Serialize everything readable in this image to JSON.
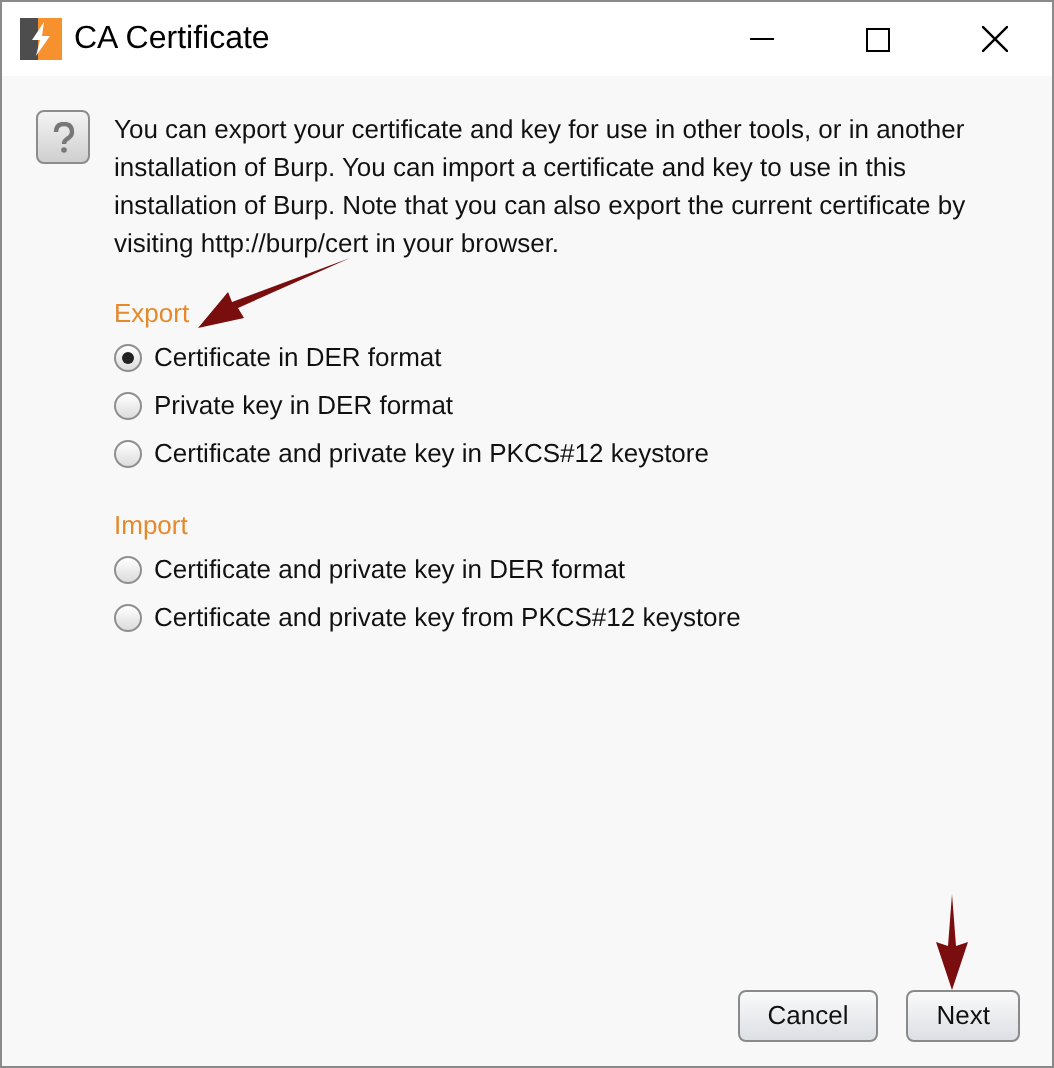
{
  "window": {
    "title": "CA Certificate"
  },
  "message": "You can export your certificate and key for use in other tools, or in another installation of Burp. You can import a certificate and key to use in this installation of Burp. Note that you can also export the current certificate by visiting http://burp/cert in your browser.",
  "sections": [
    {
      "heading": "Export",
      "options": [
        {
          "label": "Certificate in DER format",
          "selected": true
        },
        {
          "label": "Private key in DER format",
          "selected": false
        },
        {
          "label": "Certificate and private key in PKCS#12 keystore",
          "selected": false
        }
      ]
    },
    {
      "heading": "Import",
      "options": [
        {
          "label": "Certificate and private key in DER format",
          "selected": false
        },
        {
          "label": "Certificate and private key from PKCS#12 keystore",
          "selected": false
        }
      ]
    }
  ],
  "buttons": [
    "Cancel",
    "Next"
  ]
}
